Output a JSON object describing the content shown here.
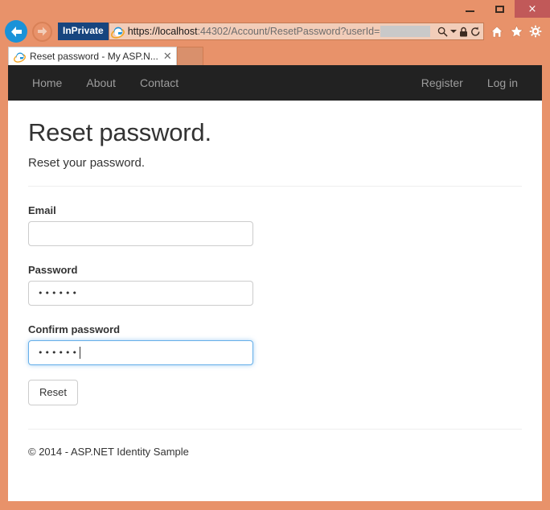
{
  "browser": {
    "window_controls": {
      "minimize": "minimize-button",
      "maximize": "maximize-button",
      "close": "×"
    },
    "inprivate_label": "InPrivate",
    "address": {
      "scheme_host": "https://localhost",
      "path": ":44302/Account/ResetPassword?userId=",
      "full_url": "https://localhost:44302/Account/ResetPassword?userId=",
      "redacted_value": ""
    },
    "address_icons": [
      "search-icon",
      "dropdown-caret",
      "lock-icon",
      "refresh-icon"
    ],
    "toolbar_icons": [
      "home-icon",
      "favorites-star-icon",
      "settings-gear-icon"
    ],
    "tab": {
      "title": "Reset password - My ASP.N...",
      "close_label": "✕"
    }
  },
  "site": {
    "nav_left": [
      {
        "label": "Home",
        "name": "nav-home"
      },
      {
        "label": "About",
        "name": "nav-about"
      },
      {
        "label": "Contact",
        "name": "nav-contact"
      }
    ],
    "nav_right": [
      {
        "label": "Register",
        "name": "nav-register"
      },
      {
        "label": "Log in",
        "name": "nav-login"
      }
    ]
  },
  "page": {
    "title": "Reset password.",
    "subtitle": "Reset your password.",
    "fields": {
      "email": {
        "label": "Email",
        "value": "",
        "placeholder": ""
      },
      "password": {
        "label": "Password",
        "value": "••••••",
        "placeholder": ""
      },
      "confirm_password": {
        "label": "Confirm password",
        "value": "••••••",
        "placeholder": "",
        "focused": true
      }
    },
    "submit_button": "Reset",
    "footer": "© 2014 - ASP.NET Identity Sample"
  },
  "colors": {
    "window_frame": "#e8926a",
    "close_button": "#c15959",
    "back_button": "#1a92d8",
    "inprivate_badge": "#17457f",
    "site_nav_bg": "#222222",
    "site_nav_link": "#9d9d9d",
    "focus_border": "#66afe9"
  }
}
